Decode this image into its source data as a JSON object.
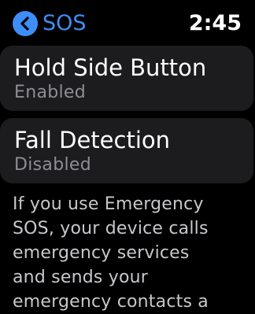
{
  "colors": {
    "accent": "#3e8ef7",
    "background": "#000000",
    "card": "#1c1c1e",
    "secondary_text": "#8e8e93"
  },
  "header": {
    "back_icon": "chevron-left-circle-icon",
    "back_label": "SOS",
    "time": "2:45"
  },
  "settings": {
    "hold_side_button": {
      "title": "Hold Side Button",
      "status": "Enabled"
    },
    "fall_detection": {
      "title": "Fall Detection",
      "status": "Disabled"
    }
  },
  "info_lines": [
    "If you use Emergency",
    "SOS, your device calls",
    "emergency services",
    "and sends your",
    "emergency contacts a"
  ]
}
